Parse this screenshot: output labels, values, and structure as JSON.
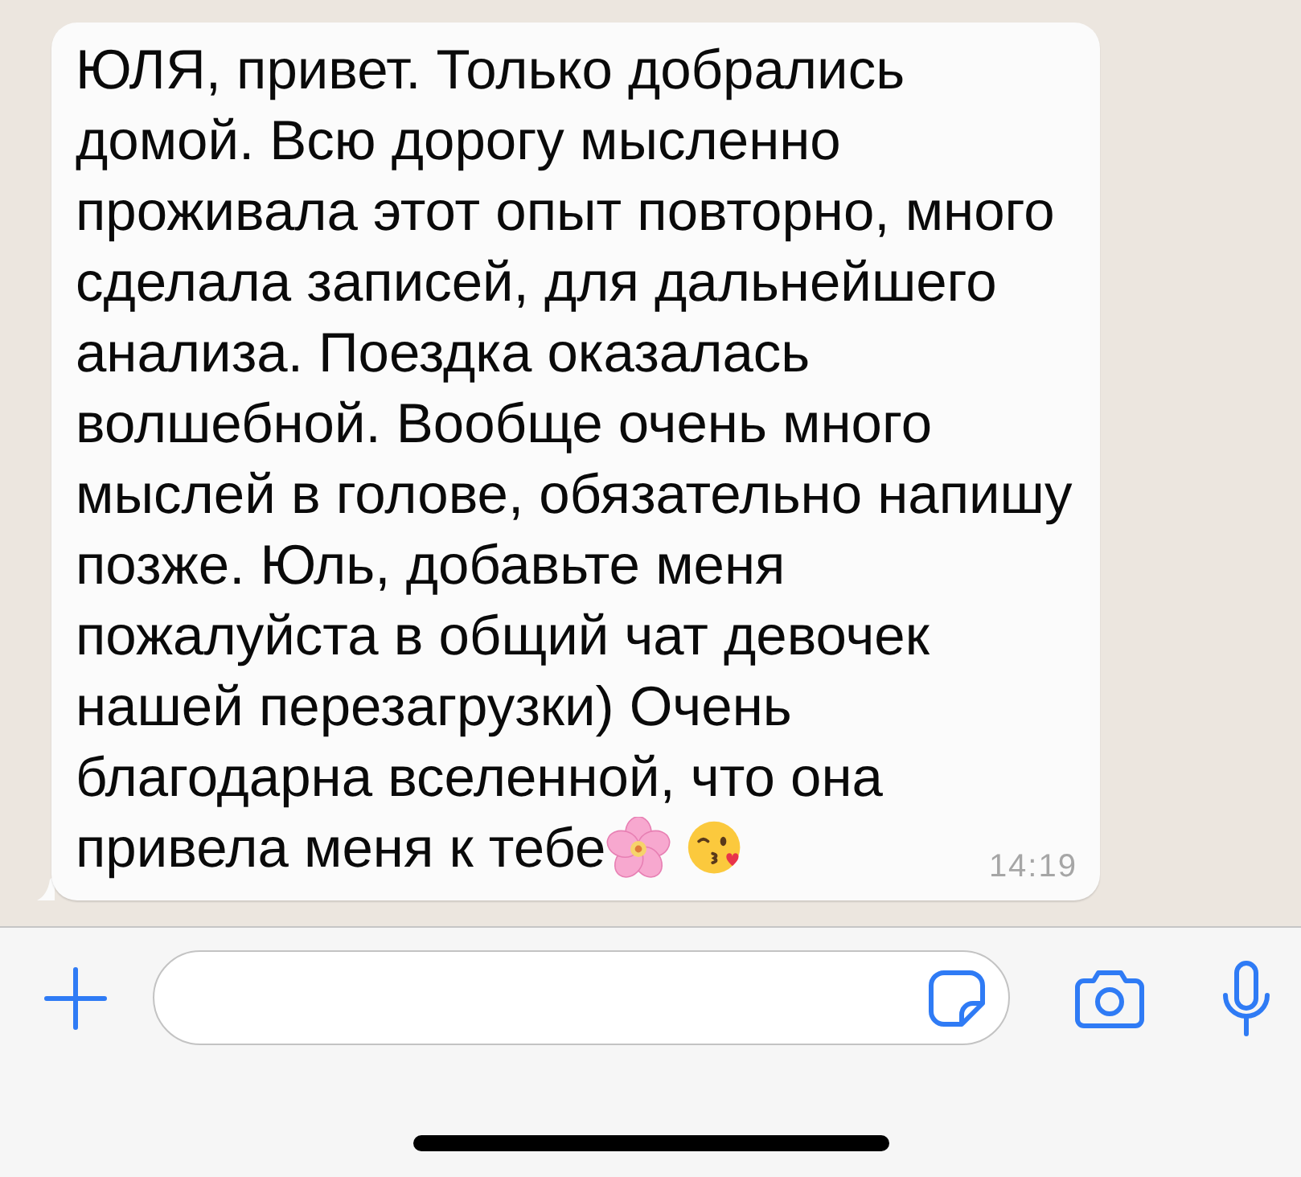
{
  "messages": [
    {
      "kind": "incoming",
      "text": "ЮЛЯ, привет. Только добрались домой. Всю дорогу мысленно проживала этот опыт повторно, много сделала записей, для дальнейшего анализа. Поездка оказалась волшебной. Вообще очень много мыслей в голове, обязательно напишу позже. Юль, добавьте меня пожалуйста в общий чат девочек нашей перезагрузки) Очень благодарна вселенной, что она",
      "last_line": "привела меня к тебе",
      "time": "14:19"
    }
  ]
}
